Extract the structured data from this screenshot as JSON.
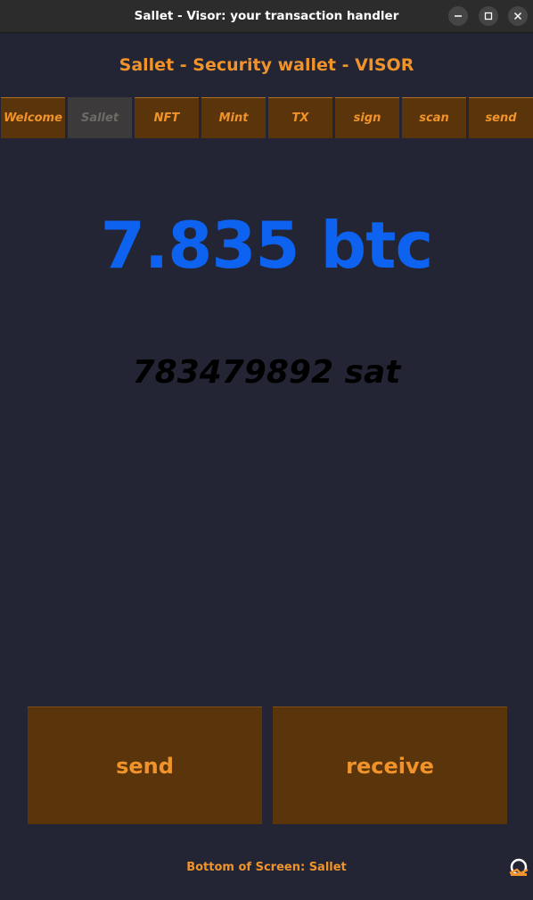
{
  "window": {
    "title": "Sallet - Visor: your transaction handler",
    "controls": [
      "minimize-icon",
      "maximize-icon",
      "close-icon"
    ]
  },
  "header": {
    "title": "Sallet - Security wallet - VISOR"
  },
  "tabs": [
    {
      "label": "Welcome",
      "active": false
    },
    {
      "label": "Sallet",
      "active": true
    },
    {
      "label": "NFT",
      "active": false
    },
    {
      "label": "Mint",
      "active": false
    },
    {
      "label": "TX",
      "active": false
    },
    {
      "label": "sign",
      "active": false
    },
    {
      "label": "scan",
      "active": false
    },
    {
      "label": "send",
      "active": false
    }
  ],
  "balance": {
    "btc": "7.835 btc",
    "sat": "783479892 sat"
  },
  "actions": {
    "send_label": "send",
    "receive_label": "receive"
  },
  "footer": {
    "text": "Bottom of Screen: Sallet",
    "icon": "keyboard-toggle-icon"
  },
  "colors": {
    "background": "#232534",
    "accent": "#f0932a",
    "button_bg": "#5a350c",
    "btc_blue": "#0d62f0",
    "active_tab_bg": "#3c3a3a"
  }
}
